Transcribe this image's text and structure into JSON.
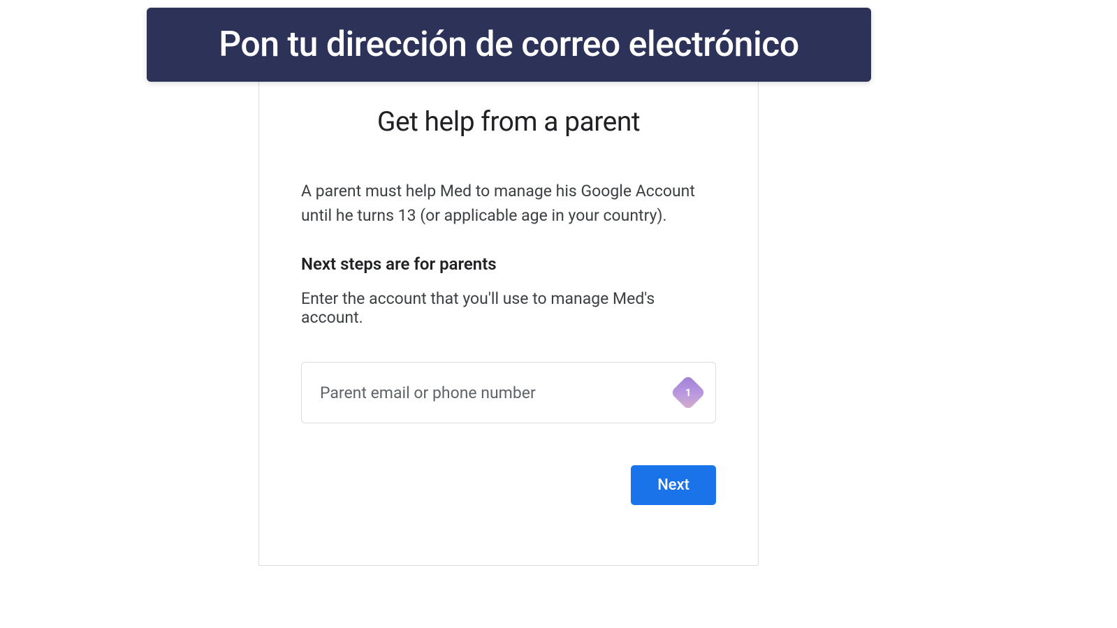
{
  "banner": {
    "title": "Pon tu dirección de correo electrónico"
  },
  "card": {
    "title": "Get help from a parent",
    "description": "A parent must help Med to manage his Google Account until he turns 13 (or applicable age in your country).",
    "subtitle": "Next steps are for parents",
    "instruction": "Enter the account that you'll use to manage Med's account.",
    "input": {
      "placeholder": "Parent email or phone number",
      "value": ""
    },
    "badge": {
      "number": "1"
    },
    "next_label": "Next"
  }
}
